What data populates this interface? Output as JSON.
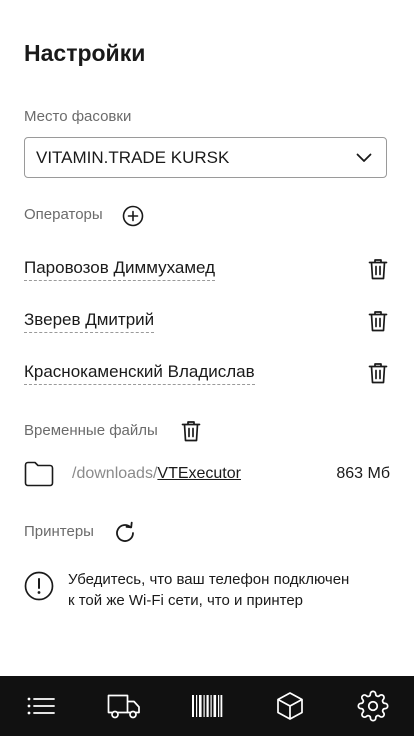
{
  "page": {
    "title": "Настройки"
  },
  "packing_place": {
    "label": "Место фасовки",
    "selected": "VITAMIN.TRADE KURSK"
  },
  "operators": {
    "label": "Операторы",
    "items": [
      {
        "name": "Паровозов Диммухамед"
      },
      {
        "name": "Зверев Дмитрий"
      },
      {
        "name": "Краснокаменский Владислав"
      }
    ]
  },
  "temp_files": {
    "label": "Временные файлы",
    "path_prefix": "/downloads/",
    "folder_name": "VTExecutor",
    "size": "863 Мб"
  },
  "printers": {
    "label": "Принтеры",
    "notice_line1": "Убедитесь, что ваш телефон подключен",
    "notice_line2": "к той же Wi-Fi сети, что и принтер"
  },
  "tabbar": {
    "tabs": [
      {
        "icon": "list-icon"
      },
      {
        "icon": "truck-icon"
      },
      {
        "icon": "barcode-icon"
      },
      {
        "icon": "box-icon"
      },
      {
        "icon": "gear-icon"
      }
    ]
  }
}
